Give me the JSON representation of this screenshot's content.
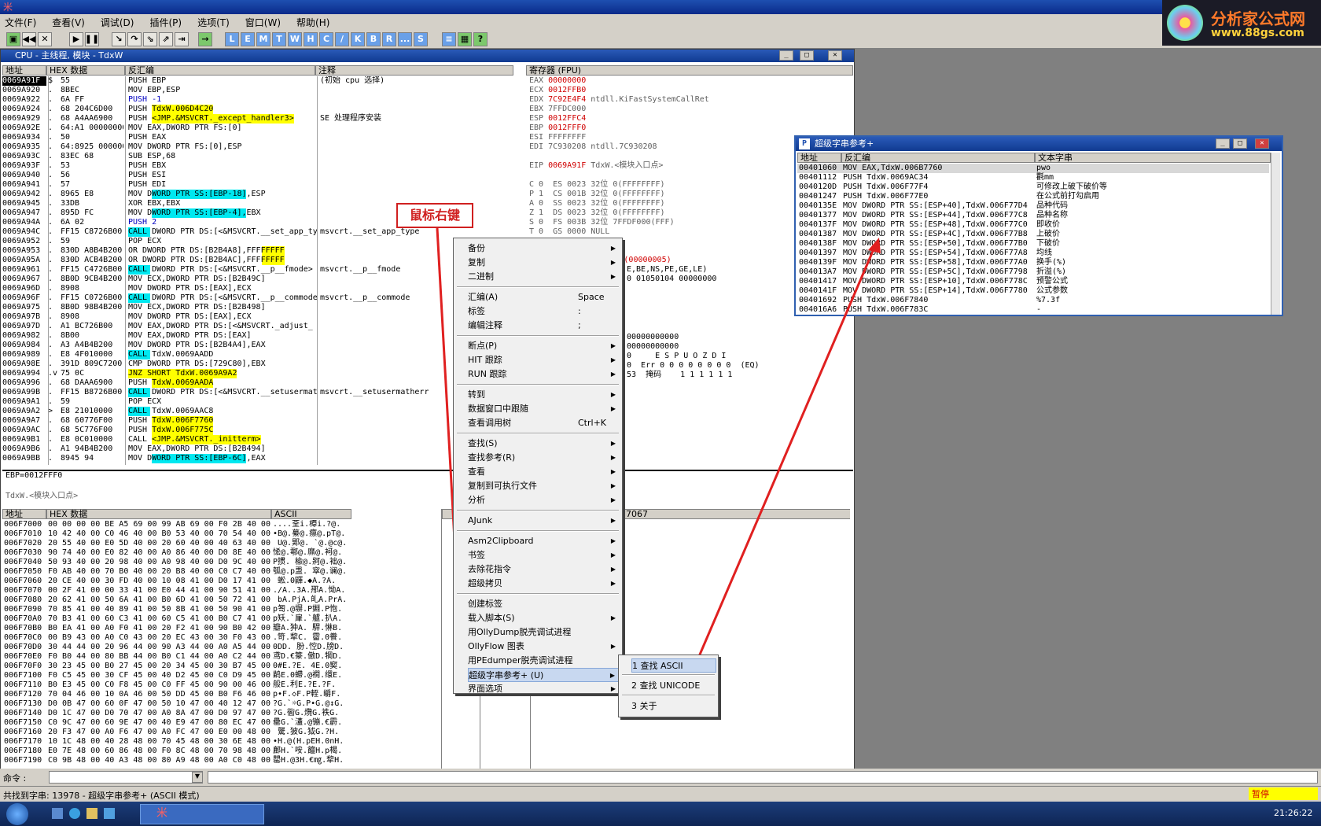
{
  "app": {
    "title_glyph": "米"
  },
  "menubar": [
    "文件(F)",
    "查看(V)",
    "调试(D)",
    "插件(P)",
    "选项(T)",
    "窗口(W)",
    "帮助(H)"
  ],
  "toolbar": {
    "letters": [
      "L",
      "E",
      "M",
      "T",
      "W",
      "H",
      "C",
      "/",
      "K",
      "B",
      "R",
      "...",
      "S"
    ]
  },
  "logo": {
    "name": "分析家公式网",
    "url": "www.88gs.com"
  },
  "cpu": {
    "title": "CPU - 主线程, 模块 - TdxW",
    "headers": {
      "addr": "地址",
      "hex": "HEX 数据",
      "disasm": "反汇编",
      "comment": "注释"
    },
    "rows": [
      {
        "a": "0069A91F",
        "m": "$",
        "h": "55",
        "d": "PUSH EBP",
        "c": "(初始 cpu 选择)"
      },
      {
        "a": "0069A920",
        "m": ".",
        "h": "8BEC",
        "d": "MOV EBP,ESP",
        "c": ""
      },
      {
        "a": "0069A922",
        "m": ".",
        "h": "6A FF",
        "d": "PUSH -1",
        "c": ""
      },
      {
        "a": "0069A924",
        "m": ".",
        "h": "68 204C6D00",
        "d": "PUSH TdxW.006D4C20",
        "c": ""
      },
      {
        "a": "0069A929",
        "m": ".",
        "h": "68 A4AA6900",
        "d": "PUSH <JMP.&MSVCRT._except_handler3>",
        "c": "SE 处理程序安装"
      },
      {
        "a": "0069A92E",
        "m": ".",
        "h": "64:A1 00000000",
        "d": "MOV EAX,DWORD PTR FS:[0]",
        "c": ""
      },
      {
        "a": "0069A934",
        "m": ".",
        "h": "50",
        "d": "PUSH EAX",
        "c": ""
      },
      {
        "a": "0069A935",
        "m": ".",
        "h": "64:8925 000000",
        "d": "MOV DWORD PTR FS:[0],ESP",
        "c": ""
      },
      {
        "a": "0069A93C",
        "m": ".",
        "h": "83EC 68",
        "d": "SUB ESP,68",
        "c": ""
      },
      {
        "a": "0069A93F",
        "m": ".",
        "h": "53",
        "d": "PUSH EBX",
        "c": ""
      },
      {
        "a": "0069A940",
        "m": ".",
        "h": "56",
        "d": "PUSH ESI",
        "c": ""
      },
      {
        "a": "0069A941",
        "m": ".",
        "h": "57",
        "d": "PUSH EDI",
        "c": ""
      },
      {
        "a": "0069A942",
        "m": ".",
        "h": "8965 E8",
        "d": "MOV DWORD PTR SS:[EBP-18],ESP",
        "c": ""
      },
      {
        "a": "0069A945",
        "m": ".",
        "h": "33DB",
        "d": "XOR EBX,EBX",
        "c": ""
      },
      {
        "a": "0069A947",
        "m": ".",
        "h": "895D FC",
        "d": "MOV DWORD PTR SS:[EBP-4],EBX",
        "c": ""
      },
      {
        "a": "0069A94A",
        "m": ".",
        "h": "6A 02",
        "d": "PUSH 2",
        "c": ""
      },
      {
        "a": "0069A94C",
        "m": ".",
        "h": "FF15 C8726B00",
        "d": "CALL DWORD PTR DS:[<&MSVCRT.__set_app_ty",
        "c": "msvcrt.__set_app_type"
      },
      {
        "a": "0069A952",
        "m": ".",
        "h": "59",
        "d": "POP ECX",
        "c": ""
      },
      {
        "a": "0069A953",
        "m": ".",
        "h": "830D A8B4B200 F",
        "d": "OR DWORD PTR DS:[B2B4A8],FFFFFFFF",
        "c": ""
      },
      {
        "a": "0069A95A",
        "m": ".",
        "h": "830D ACB4B200 F",
        "d": "OR DWORD PTR DS:[B2B4AC],FFFFFFFF",
        "c": ""
      },
      {
        "a": "0069A961",
        "m": ".",
        "h": "FF15 C4726B00",
        "d": "CALL DWORD PTR DS:[<&MSVCRT.__p__fmode>",
        "c": "msvcrt.__p__fmode"
      },
      {
        "a": "0069A967",
        "m": ".",
        "h": "8B0D 9CB4B200",
        "d": "MOV ECX,DWORD PTR DS:[B2B49C]",
        "c": ""
      },
      {
        "a": "0069A96D",
        "m": ".",
        "h": "8908",
        "d": "MOV DWORD PTR DS:[EAX],ECX",
        "c": ""
      },
      {
        "a": "0069A96F",
        "m": ".",
        "h": "FF15 C0726B00",
        "d": "CALL DWORD PTR DS:[<&MSVCRT.__p__commode",
        "c": "msvcrt.__p__commode"
      },
      {
        "a": "0069A975",
        "m": ".",
        "h": "8B0D 98B4B200",
        "d": "MOV ECX,DWORD PTR DS:[B2B498]",
        "c": ""
      },
      {
        "a": "0069A97B",
        "m": ".",
        "h": "8908",
        "d": "MOV DWORD PTR DS:[EAX],ECX",
        "c": ""
      },
      {
        "a": "0069A97D",
        "m": ".",
        "h": "A1 BC726B00",
        "d": "MOV EAX,DWORD PTR DS:[<&MSVCRT._adjust_",
        "c": ""
      },
      {
        "a": "0069A982",
        "m": ".",
        "h": "8B00",
        "d": "MOV EAX,DWORD PTR DS:[EAX]",
        "c": ""
      },
      {
        "a": "0069A984",
        "m": ".",
        "h": "A3 A4B4B200",
        "d": "MOV DWORD PTR DS:[B2B4A4],EAX",
        "c": ""
      },
      {
        "a": "0069A989",
        "m": ".",
        "h": "E8 4F010000",
        "d": "CALL TdxW.0069AADD",
        "c": ""
      },
      {
        "a": "0069A98E",
        "m": ".",
        "h": "391D 809C7200",
        "d": "CMP DWORD PTR DS:[729C80],EBX",
        "c": ""
      },
      {
        "a": "0069A994",
        "m": ".v",
        "h": "75 0C",
        "d": "JNZ SHORT TdxW.0069A9A2",
        "c": ""
      },
      {
        "a": "0069A996",
        "m": ".",
        "h": "68 DAAA6900",
        "d": "PUSH TdxW.0069AADA",
        "c": ""
      },
      {
        "a": "0069A99B",
        "m": ".",
        "h": "FF15 B8726B00",
        "d": "CALL DWORD PTR DS:[<&MSVCRT.__setusermat",
        "c": "msvcrt.__setusermatherr"
      },
      {
        "a": "0069A9A1",
        "m": ".",
        "h": "59",
        "d": "POP ECX",
        "c": ""
      },
      {
        "a": "0069A9A2",
        "m": ">",
        "h": "E8 21010000",
        "d": "CALL TdxW.0069AAC8",
        "c": ""
      },
      {
        "a": "0069A9A7",
        "m": ".",
        "h": "68 60776F00",
        "d": "PUSH TdxW.006F7760",
        "c": ""
      },
      {
        "a": "0069A9AC",
        "m": ".",
        "h": "68 5C776F00",
        "d": "PUSH TdxW.006F775C",
        "c": ""
      },
      {
        "a": "0069A9B1",
        "m": ".",
        "h": "E8 0C010000",
        "d": "CALL <JMP.&MSVCRT._initterm>",
        "c": ""
      },
      {
        "a": "0069A9B6",
        "m": ".",
        "h": "A1 94B4B200",
        "d": "MOV EAX,DWORD PTR DS:[B2B494]",
        "c": ""
      },
      {
        "a": "0069A9BB",
        "m": ".",
        "h": "8945 94",
        "d": "MOV DWORD PTR SS:[EBP-6C],EAX",
        "c": ""
      }
    ],
    "info1": "EBP=0012FFF0",
    "info2": "TdxW.<模块入口点>",
    "registers_title": "寄存器 (FPU)",
    "registers": [
      "EAX 00000000",
      "ECX 0012FFB0",
      "EDX 7C92E4F4 ntdll.KiFastSystemCallRet",
      "EBX 7FFDC000",
      "ESP 0012FFC4",
      "EBP 0012FFF0",
      "ESI FFFFFFFF",
      "EDI 7C930208 ntdll.7C930208",
      "",
      "EIP 0069A91F TdxW.<模块入口点>",
      "",
      "C 0  ES 0023 32位 0(FFFFFFFF)",
      "P 1  CS 001B 32位 0(FFFFFFFF)",
      "A 0  SS 0023 32位 0(FFFFFFFF)",
      "Z 1  DS 0023 32位 0(FFFFFFFF)",
      "S 0  FS 003B 32位 7FFDF000(FFF)",
      "T 0  GS 0000 NULL",
      "D 0",
      "",
      "ERROR_ACCESS_DENIED (00000005)"
    ],
    "regs_extra": [
      "E,BE,NS,PE,GE,LE)",
      "0 01050104 00000000",
      "00000000000",
      "00000000000",
      "0     E S P U O Z D I",
      "0  Err 0 0 0 0 0 0 0 0  (EQ)",
      "53  掩码    1 1 1 1 1 1"
    ],
    "dump_headers": {
      "addr": "地址",
      "hex": "HEX 数据",
      "ascii": "ASCII"
    },
    "dump": [
      [
        "006F7000",
        "00 00 00 00 BE A5 69 00 99 AB 69 00 F0 2B 40 00",
        "....荃i.樽i.?@."
      ],
      [
        "006F7010",
        "10 42 40 00 C0 46 40 00 B0 53 40 00 70 54 40 00",
        "•B@.繤@.癝@.pT@."
      ],
      [
        "006F7020",
        "20 55 40 00 E0 5D 40 00 20 60 40 00 40 63 40 00",
        " U@.郹@. `@.@c@."
      ],
      [
        "006F7030",
        "90 74 40 00 E0 82 40 00 A0 86 40 00 D0 8E 40 00",
        "恡@.鄠@.爢@.袔@."
      ],
      [
        "006F7040",
        "50 93 40 00 20 98 40 00 A0 98 40 00 D0 9C 40 00",
        "P掼. 楡@.牁@.袦@."
      ],
      [
        "006F7050",
        "F0 AB 40 00 70 B0 40 00 20 B8 40 00 C0 C7 40 00",
        "瓠@.p盄. 窣@.谰@."
      ],
      [
        "006F7060",
        "20 CE 40 00 30 FD 40 00 10 08 41 00 D0 17 41 00",
        " 蜙.0鼲.◆A.?A."
      ],
      [
        "006F7070",
        "00 2F 41 00 00 33 41 00 E0 44 41 00 90 51 41 00",
        "./A..3A.郉A.怮A."
      ],
      [
        "006F7080",
        "20 62 41 00 50 6A 41 00 B0 6D 41 00 50 72 41 00",
        " bA.PjA.癿A.PrA."
      ],
      [
        "006F7090",
        "70 85 41 00 40 89 41 00 50 8B 41 00 50 90 41 00",
        "p匒.@塀.P婣.P怉."
      ],
      [
        "006F70A0",
        "70 B3 41 00 60 C3 41 00 60 C5 41 00 B0 C7 41 00",
        "p矨.`肁.`艫.扒A."
      ],
      [
        "006F70B0",
        "B0 EA 41 00 A0 F0 41 00 20 F2 41 00 90 B0 42 00",
        "瓣A.狆A. 駻.惏B."
      ],
      [
        "006F70C0",
        "00 B9 43 00 A0 C0 43 00 20 EC 43 00 30 F0 43 00",
        ".笴.犂C. 霤.0餋."
      ],
      [
        "006F70D0",
        "30 44 44 00 20 96 44 00 90 A3 44 00 A0 A5 44 00",
        "0DD. 朌.悾D.牓D."
      ],
      [
        "006F70E0",
        "F0 B0 44 00 80 BB 44 00 B0 C1 44 00 A0 C2 44 00",
        "鸢D.€籇.傲D.犅D."
      ],
      [
        "006F70F0",
        "30 23 45 00 B0 27 45 00 20 34 45 00 30 B7 45 00",
        "0#E.?E. 4E.0窫."
      ],
      [
        "006F7100",
        "F0 C5 45 00 30 CF 45 00 40 D2 45 00 C0 D9 45 00",
        "鹋E.0螮.@襇.缳E."
      ],
      [
        "006F7110",
        "B0 E3 45 00 C0 F8 45 00 C0 FF 45 00 90 00 46 00",
        "般E.利E.?E.?F."
      ],
      [
        "006F7120",
        "70 04 46 00 10 0A 46 00 50 DD 45 00 B0 F6 46 00",
        "p•F.◇F.P輊.皭F."
      ],
      [
        "006F7130",
        "D0 0B 47 00 60 0F 47 00 50 10 47 00 40 12 47 00",
        "?G.`☼G.P•G.@↕G."
      ],
      [
        "006F7140",
        "D0 1C 47 00 D0 70 47 00 A0 8A 47 00 D0 97 47 00",
        "?G.衟G.爦G.袟G."
      ],
      [
        "006F7150",
        "C0 9C 47 00 60 9E 47 00 40 E9 47 00 80 EC 47 00",
        "罍G.`濭.@镚.€霨."
      ],
      [
        "006F7160",
        "20 F3 47 00 A0 F6 47 00 A0 FC 47 00 E0 00 48 00",
        " 驡.狓G.狘G.?H."
      ],
      [
        "006F7170",
        "10 1C 48 00 40 28 48 00 70 45 48 00 30 6E 48 00",
        "•H.@(H.pEH.0nH."
      ],
      [
        "006F7180",
        "E0 7E 48 00 60 86 48 00 F0 8C 48 00 70 98 48 00",
        "鄜H.`咹.饘H.p楬."
      ],
      [
        "006F7190",
        "C0 9B 48 00 40 A3 48 00 80 A9 48 00 A0 C0 48 00",
        "罌H.@3H.€㎎.犂H."
      ]
    ],
    "stack_hint": "17067"
  },
  "context_menu": {
    "items": [
      {
        "label": "备份",
        "sc": "",
        "arrow": true
      },
      {
        "label": "复制",
        "sc": "",
        "arrow": true
      },
      {
        "label": "二进制",
        "sc": "",
        "arrow": true
      },
      {
        "label": "汇编(A)",
        "sc": "Space",
        "arrow": false
      },
      {
        "label": "标签",
        "sc": ":",
        "arrow": false
      },
      {
        "label": "编辑注释",
        "sc": ";",
        "arrow": false
      },
      {
        "label": "断点(P)",
        "sc": "",
        "arrow": true
      },
      {
        "label": "HIT 跟踪",
        "sc": "",
        "arrow": true
      },
      {
        "label": "RUN 跟踪",
        "sc": "",
        "arrow": true
      },
      {
        "label": "转到",
        "sc": "",
        "arrow": true
      },
      {
        "label": "数据窗口中跟随",
        "sc": "",
        "arrow": true
      },
      {
        "label": "查看调用树",
        "sc": "Ctrl+K",
        "arrow": false
      },
      {
        "label": "查找(S)",
        "sc": "",
        "arrow": true
      },
      {
        "label": "查找参考(R)",
        "sc": "",
        "arrow": true
      },
      {
        "label": "查看",
        "sc": "",
        "arrow": true
      },
      {
        "label": "复制到可执行文件",
        "sc": "",
        "arrow": true
      },
      {
        "label": "分析",
        "sc": "",
        "arrow": true
      },
      {
        "label": "AJunk",
        "sc": "",
        "arrow": true
      },
      {
        "label": "Asm2Clipboard",
        "sc": "",
        "arrow": true
      },
      {
        "label": "书签",
        "sc": "",
        "arrow": true
      },
      {
        "label": "去除花指令",
        "sc": "",
        "arrow": true
      },
      {
        "label": "超级拷贝",
        "sc": "",
        "arrow": true
      },
      {
        "label": "创建标签",
        "sc": "",
        "arrow": false
      },
      {
        "label": "载入脚本(S)",
        "sc": "",
        "arrow": true
      },
      {
        "label": "用OllyDump脱壳调试进程",
        "sc": "",
        "arrow": false
      },
      {
        "label": "OllyFlow 图表",
        "sc": "",
        "arrow": true
      },
      {
        "label": "用PEdumper脱壳调试进程",
        "sc": "",
        "arrow": false
      },
      {
        "label": "超级字串参考+ (U)",
        "sc": "",
        "arrow": true
      },
      {
        "label": "界面选项",
        "sc": "",
        "arrow": true
      }
    ]
  },
  "submenu": {
    "items": [
      "1 查找 ASCII",
      "2 查找 UNICODE",
      "3 关于"
    ]
  },
  "strwin": {
    "title": "超级字串参考+",
    "headers": {
      "addr": "地址",
      "disasm": "反汇编",
      "text": "文本字串"
    },
    "rows": [
      [
        "00401060",
        "MOV EAX,TdxW.006B7760",
        "pwo"
      ],
      [
        "00401112",
        "PUSH TdxW.0069AC34",
        "氍mm"
      ],
      [
        "0040120D",
        "PUSH TdxW.006F77F4",
        "可修改上破下破价等"
      ],
      [
        "00401247",
        "PUSH TdxW.006F77E0",
        "在公式前打勾启用"
      ],
      [
        "0040135E",
        "MOV DWORD PTR SS:[ESP+40],TdxW.006F77D4",
        "品种代码"
      ],
      [
        "00401377",
        "MOV DWORD PTR SS:[ESP+44],TdxW.006F77C8",
        "品种名称"
      ],
      [
        "0040137F",
        "MOV DWORD PTR SS:[ESP+48],TdxW.006F77C0",
        "即收价"
      ],
      [
        "00401387",
        "MOV DWORD PTR SS:[ESP+4C],TdxW.006F77B8",
        "上破价"
      ],
      [
        "0040138F",
        "MOV DWORD PTR SS:[ESP+50],TdxW.006F77B0",
        "下破价"
      ],
      [
        "00401397",
        "MOV DWORD PTR SS:[ESP+54],TdxW.006F77A8",
        "均线"
      ],
      [
        "0040139F",
        "MOV DWORD PTR SS:[ESP+58],TdxW.006F77A0",
        "换手(%)"
      ],
      [
        "004013A7",
        "MOV DWORD PTR SS:[ESP+5C],TdxW.006F7798",
        "折溢(%)"
      ],
      [
        "00401417",
        "MOV DWORD PTR SS:[ESP+10],TdxW.006F778C",
        "预警公式"
      ],
      [
        "0040141F",
        "MOV DWORD PTR SS:[ESP+14],TdxW.006F7780",
        "公式参数"
      ],
      [
        "00401692",
        "PUSH TdxW.006F7840",
        "%7.3f"
      ],
      [
        "004016A6",
        "PUSH TdxW.006F783C",
        "-"
      ]
    ]
  },
  "annotation": "鼠标右键",
  "command": {
    "label": "命令 :"
  },
  "status": {
    "text": "共找到字串: 13978  -  超级字串参考+ (ASCII 模式)",
    "state": "暂停"
  },
  "taskbar": {
    "clock": "21:26:22"
  }
}
